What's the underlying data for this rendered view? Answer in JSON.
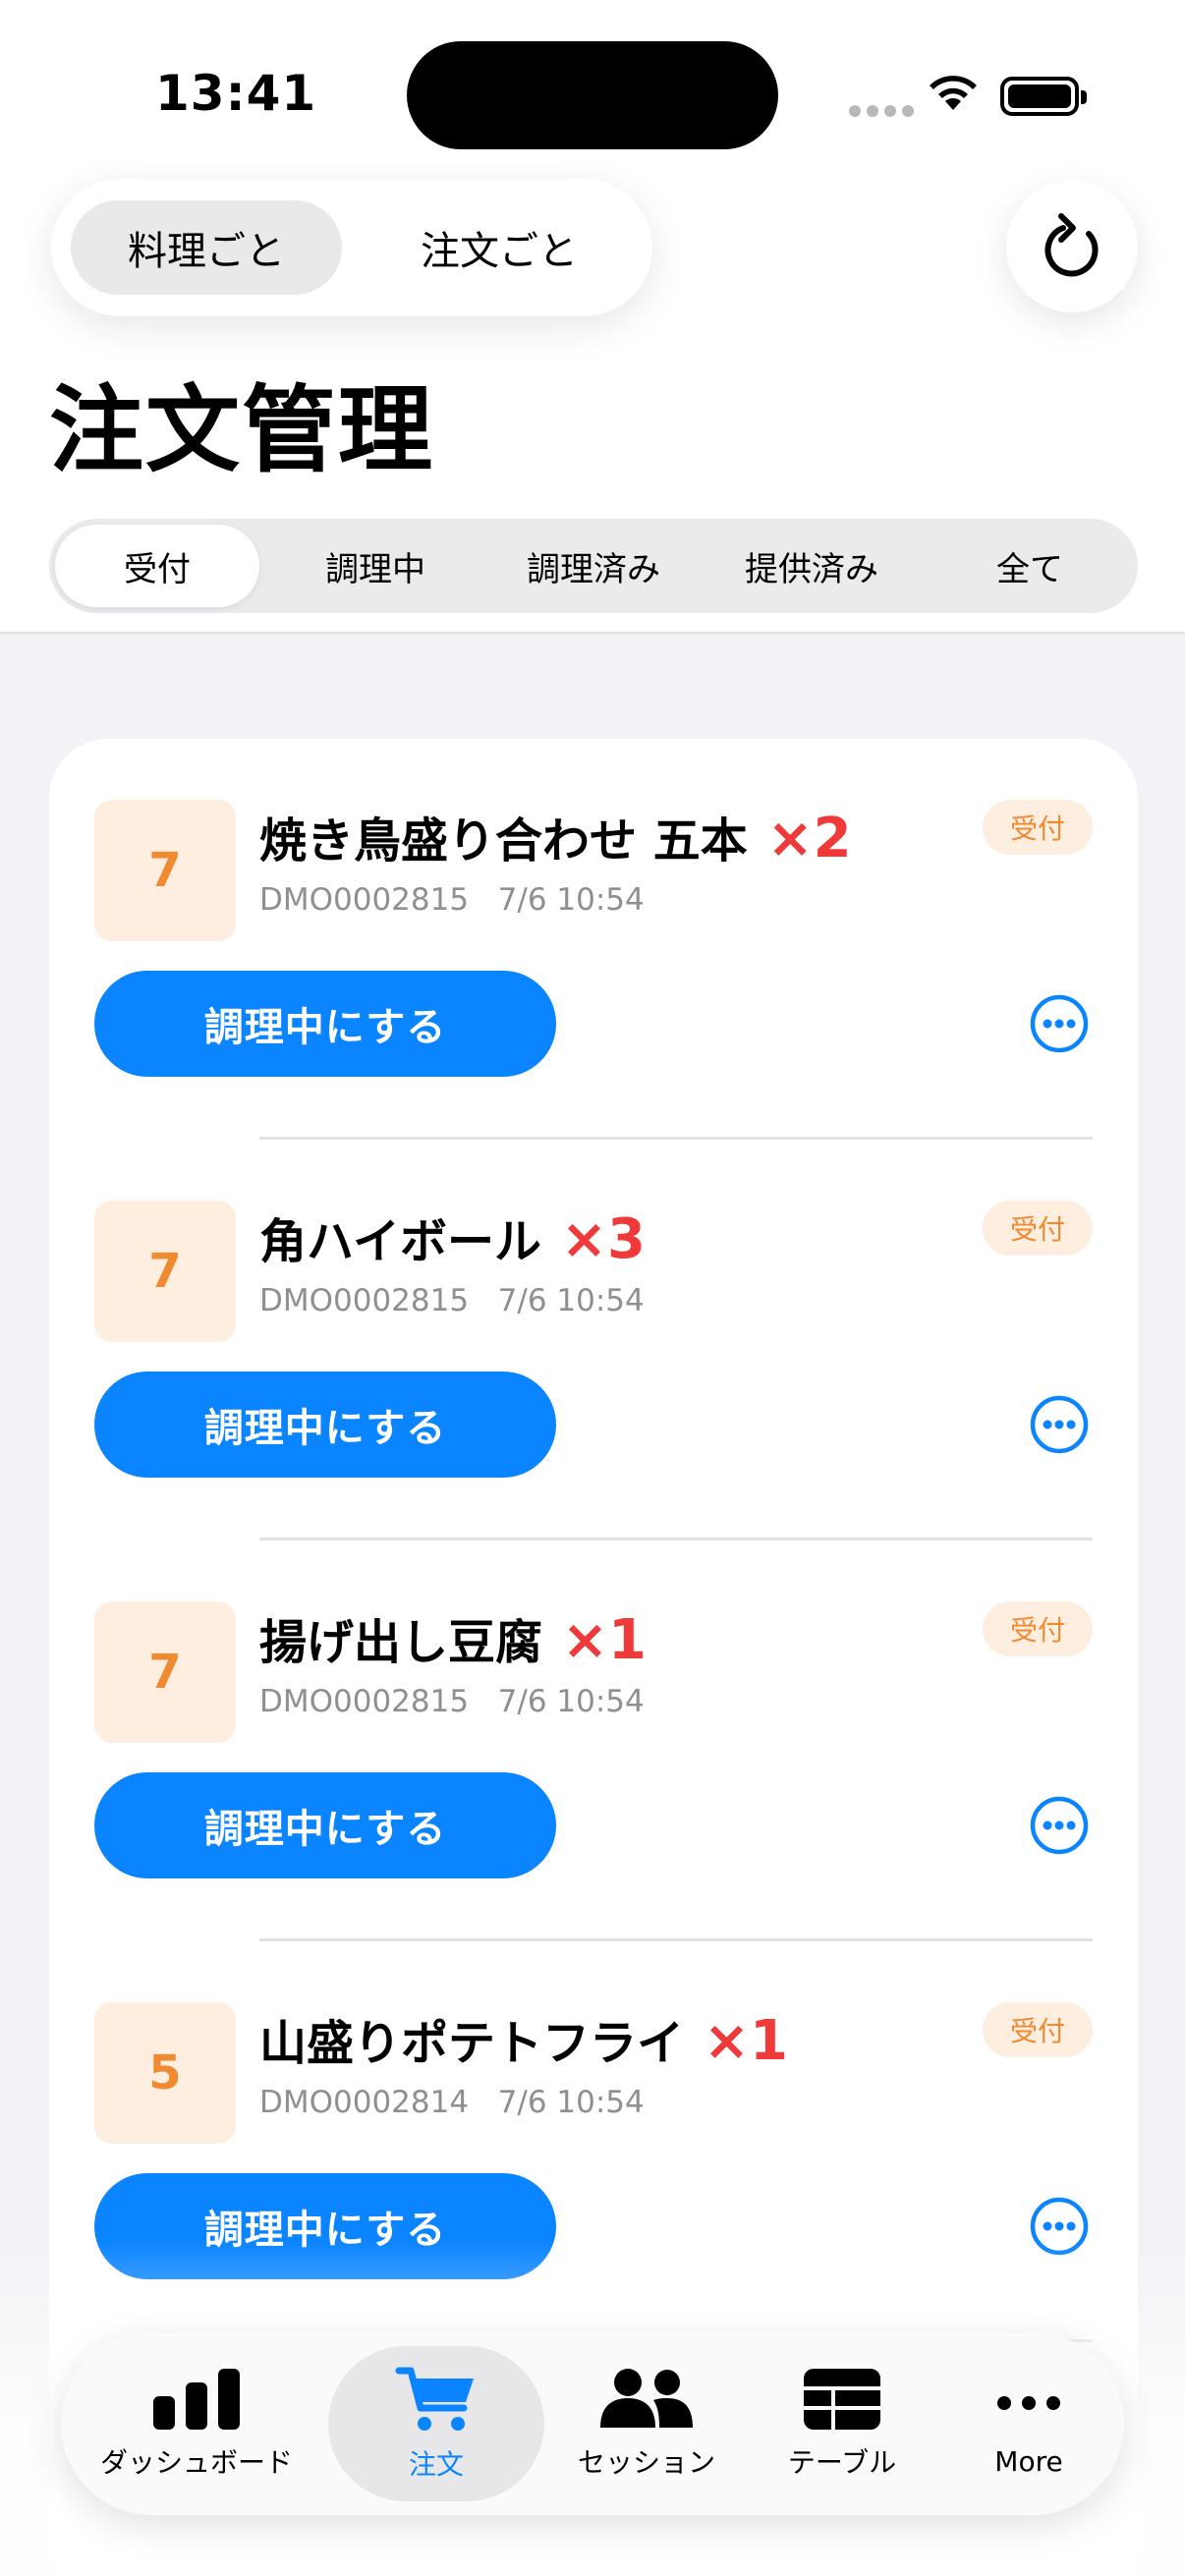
{
  "status_bar": {
    "time": "13:41"
  },
  "view_toggle": {
    "options": [
      "料理ごと",
      "注文ごと"
    ],
    "selected": "料理ごと"
  },
  "page": {
    "title": "注文管理"
  },
  "filters": {
    "tabs": [
      "受付",
      "調理中",
      "調理済み",
      "提供済み",
      "全て"
    ],
    "selected": "受付"
  },
  "orders": [
    {
      "table": "7",
      "name": "焼き鳥盛り合わせ 五本",
      "qty": "×2",
      "order_id": "DMO0002815",
      "time": "7/6 10:54",
      "status": "受付",
      "action": "調理中にする"
    },
    {
      "table": "7",
      "name": "角ハイボール",
      "qty": "×3",
      "order_id": "DMO0002815",
      "time": "7/6 10:54",
      "status": "受付",
      "action": "調理中にする"
    },
    {
      "table": "7",
      "name": "揚げ出し豆腐",
      "qty": "×1",
      "order_id": "DMO0002815",
      "time": "7/6 10:54",
      "status": "受付",
      "action": "調理中にする"
    },
    {
      "table": "5",
      "name": "山盛りポテトフライ",
      "qty": "×1",
      "order_id": "DMO0002814",
      "time": "7/6 10:54",
      "status": "受付",
      "action": "調理中にする"
    }
  ],
  "tab_bar": {
    "items": [
      {
        "label": "ダッシュボード",
        "icon": "bar-chart-icon"
      },
      {
        "label": "注文",
        "icon": "cart-icon"
      },
      {
        "label": "セッション",
        "icon": "people-icon"
      },
      {
        "label": "テーブル",
        "icon": "table-icon"
      },
      {
        "label": "More",
        "icon": "more-icon"
      }
    ],
    "selected": "注文"
  },
  "colors": {
    "accent": "#0a84ff",
    "status_orange": "#f08a30",
    "qty_red": "#f03a3a"
  }
}
